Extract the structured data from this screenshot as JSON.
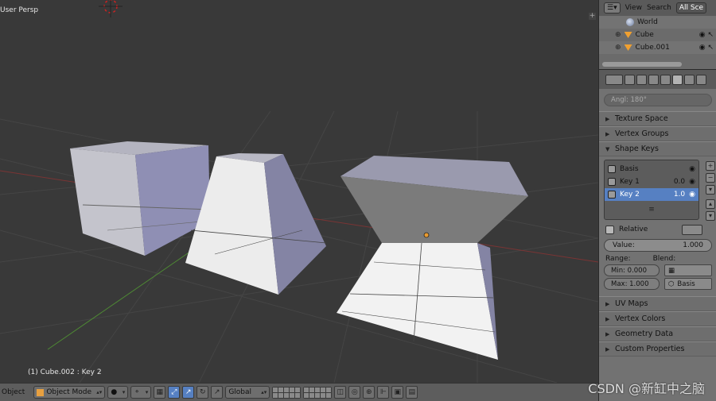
{
  "viewport": {
    "mode_label": "User Persp",
    "object_label": "(1) Cube.002 : Key 2"
  },
  "header": {
    "object_menu": "Object",
    "mode": "Object Mode",
    "orientation": "Global"
  },
  "outliner": {
    "view_btn": "View",
    "search_btn": "Search",
    "all_scenes_btn": "All Sce",
    "rows": [
      {
        "label": "World",
        "icon": "world-icon"
      },
      {
        "label": "Cube",
        "icon": "mesh-object-icon"
      },
      {
        "label": "Cube.001",
        "icon": "mesh-object-icon"
      }
    ]
  },
  "properties": {
    "angle_field": "Angl: 180°",
    "panels": {
      "texture_space": "Texture Space",
      "vertex_groups": "Vertex Groups",
      "shape_keys": "Shape Keys",
      "uv_maps": "UV Maps",
      "vertex_colors": "Vertex Colors",
      "geometry_data": "Geometry Data",
      "custom_properties": "Custom Properties"
    },
    "shape_keys": [
      {
        "name": "Basis",
        "value": ""
      },
      {
        "name": "Key 1",
        "value": "0.0"
      },
      {
        "name": "Key 2",
        "value": "1.0"
      }
    ],
    "relative_label": "Relative",
    "value_label": "Value:",
    "value": "1.000",
    "range_label": "Range:",
    "blend_label": "Blend:",
    "min_label": "Min:",
    "min_value": "0.000",
    "max_label": "Max:",
    "max_value": "1.000",
    "blend_target": "Basis"
  },
  "watermark": "CSDN @新缸中之脑",
  "colors": {
    "viewport_bg": "#393939",
    "panel_bg": "#727272",
    "selection": "#5680c2",
    "grid_red_axis": "#9b3a3a",
    "grid_green_axis": "#5a9a3a"
  }
}
